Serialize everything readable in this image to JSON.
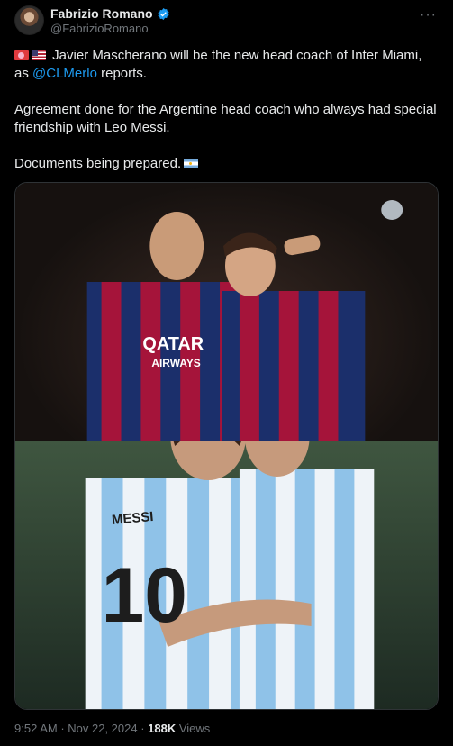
{
  "author": {
    "name": "Fabrizio Romano",
    "handle": "@FabrizioRomano"
  },
  "post": {
    "line1_main": "Javier Mascherano will be the new head coach of Inter Miami, as",
    "mention": "@CLMerlo",
    "line1_end": " reports.",
    "para2": "Agreement done for the Argentine head coach who always had special friendship with Leo Messi.",
    "para3": "Documents being prepared."
  },
  "media": {
    "top_jersey_sponsor": "QATAR AIRWAYS",
    "bottom_jersey_name": "MESSI",
    "bottom_jersey_number": "10"
  },
  "meta": {
    "time": "9:52 AM",
    "sep1": " · ",
    "date": "Nov 22, 2024",
    "sep2": " · ",
    "views_count": "188K",
    "views_label": " Views"
  },
  "colors": {
    "accent": "#1d9bf0",
    "background": "#000000",
    "text": "#e7e9ea",
    "muted": "#71767b"
  }
}
